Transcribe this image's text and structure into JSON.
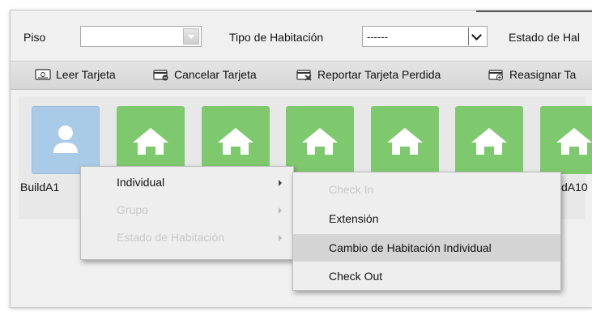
{
  "filters": {
    "floor_label": "Piso",
    "floor_value": "",
    "room_type_label": "Tipo de Habitación",
    "room_type_value": "------",
    "room_state_label": "Estado de Hal"
  },
  "toolbar": {
    "read_card": "Leer Tarjeta",
    "cancel_card": "Cancelar Tarjeta",
    "report_lost": "Reportar Tarjeta Perdida",
    "reassign": "Reasignar Ta"
  },
  "rooms": {
    "first_label": "BuildA1",
    "last_label": "dA10"
  },
  "context_menu": {
    "items": [
      {
        "label": "Individual",
        "enabled": true
      },
      {
        "label": "Grupo",
        "enabled": false
      },
      {
        "label": "Estado de Habitación",
        "enabled": false
      }
    ]
  },
  "submenu": {
    "items": [
      {
        "label": "Check In",
        "enabled": false
      },
      {
        "label": "Extensión",
        "enabled": true
      },
      {
        "label": "Cambio de Habitación Individual",
        "enabled": true,
        "highlighted": true
      },
      {
        "label": "Check Out",
        "enabled": true
      }
    ]
  },
  "colors": {
    "tile_available": "#7ec96e",
    "tile_selected": "#a9cbe8",
    "menu_highlight": "#d4d4d4"
  }
}
